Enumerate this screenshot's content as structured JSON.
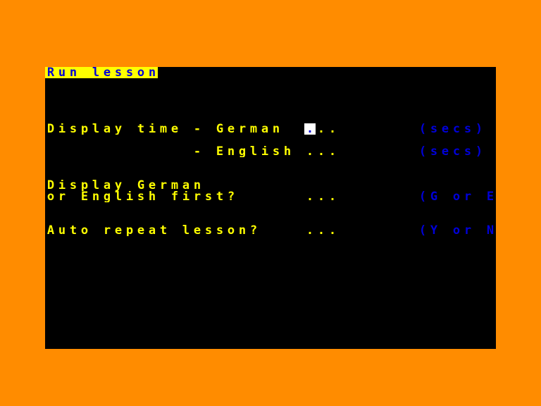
{
  "screen": {
    "border_color": "#ff8c00",
    "paper_color": "#000000",
    "ink_color": "#ffff00",
    "accent_color": "#0000d8",
    "highlight_color": "#ffff00",
    "cursor_color": "#ffffff",
    "columns": 40,
    "rows": 24,
    "char_width": 16,
    "char_height": 16
  },
  "title": {
    "text": "Run lesson",
    "ink": "#0000d8",
    "paper": "#ffff00"
  },
  "fields": {
    "display_time_german": {
      "label": "Display time - German",
      "dots": "...",
      "hint": "(secs)",
      "value": "",
      "cursor": true
    },
    "display_time_english": {
      "label": "- English",
      "dots": "...",
      "hint": "(secs)",
      "value": "",
      "cursor": false
    },
    "first_language": {
      "label_line1": "Display German",
      "label_line2": "or English first?",
      "dots": "...",
      "hint": "(G or E)",
      "value": "",
      "cursor": false
    },
    "auto_repeat": {
      "label": "Auto repeat lesson?",
      "dots": "...",
      "hint": "(Y or N)",
      "value": "",
      "cursor": false
    }
  }
}
